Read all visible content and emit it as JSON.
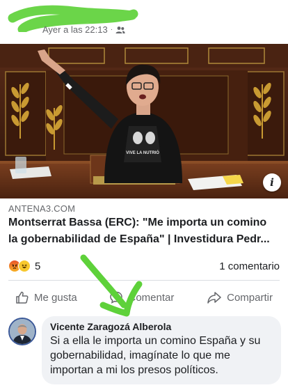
{
  "post": {
    "timestamp": "Ayer a las 22:13",
    "separator": "·",
    "audience_icon": "friends-icon"
  },
  "link": {
    "domain": "ANTENA3.COM",
    "title_line1": "Montserrat Bassa (ERC): \"Me importa un comino",
    "title_line2": "la gobernabilidad de España\" | Investidura Pedr..."
  },
  "media": {
    "info_label": "i",
    "shirt_text": "VIVE LA NUTRIÓ"
  },
  "reactions": {
    "icons": [
      "angry-icon",
      "haha-icon"
    ],
    "count": "5",
    "comments": "1 comentario"
  },
  "actions": {
    "like": "Me gusta",
    "comment": "Comentar",
    "share": "Compartir"
  },
  "comment": {
    "author": "Vicente Zaragozá Alberola",
    "text": "Si a ella le importa un comino España y su gobernabilidad, imagínate lo que me importan a mi los presos políticos."
  },
  "colors": {
    "scribble": "#5ed13a",
    "secondary_text": "#65676b",
    "bubble": "#f0f2f5"
  }
}
